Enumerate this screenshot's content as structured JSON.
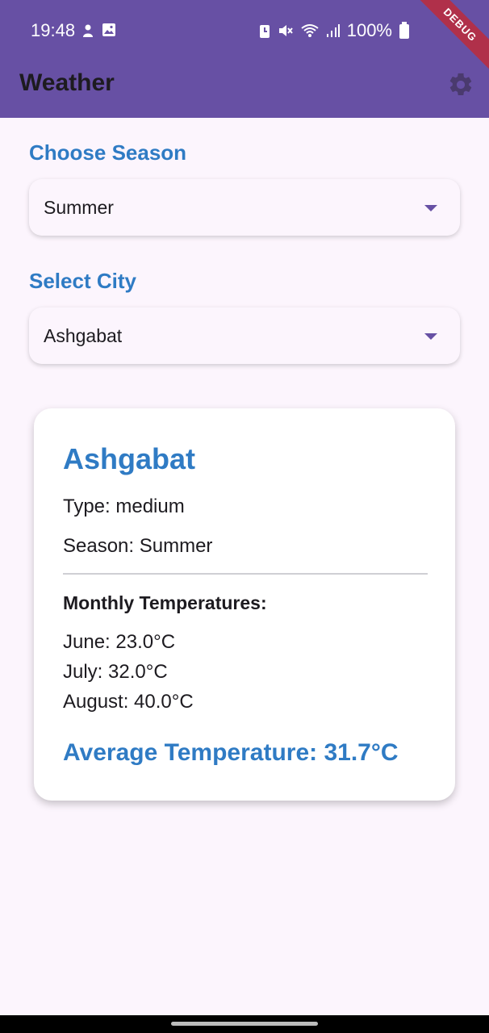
{
  "status_bar": {
    "time": "19:48",
    "battery": "100%"
  },
  "app_bar": {
    "title": "Weather",
    "debug_banner": "DEBUG"
  },
  "season": {
    "label": "Choose Season",
    "selected": "Summer"
  },
  "city": {
    "label": "Select City",
    "selected": "Ashgabat"
  },
  "card": {
    "city": "Ashgabat",
    "type": "Type: medium",
    "season": "Season: Summer",
    "monthly_title": "Monthly Temperatures:",
    "months": [
      "June: 23.0°C",
      "July: 32.0°C",
      "August: 40.0°C"
    ],
    "average": "Average Temperature: 31.7°C"
  },
  "colors": {
    "app_bar": "#6750a4",
    "accent_blue": "#2f7bc4",
    "background": "#fcf5fd"
  }
}
